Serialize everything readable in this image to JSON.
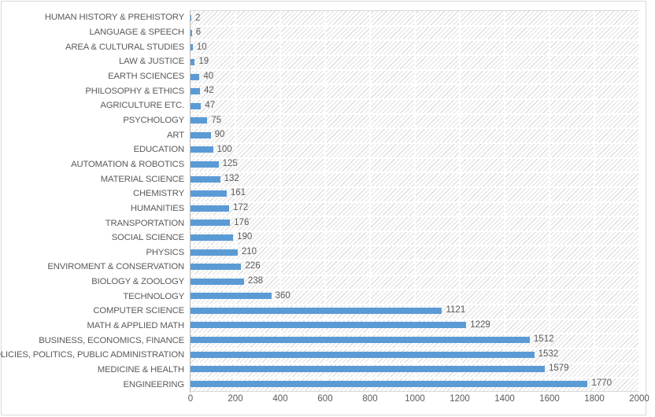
{
  "chart_data": {
    "type": "bar",
    "orientation": "horizontal",
    "title": "",
    "subtitle": "",
    "xlabel": "",
    "ylabel": "",
    "xlim": [
      0,
      2000
    ],
    "xticks": [
      0,
      200,
      400,
      600,
      800,
      1000,
      1200,
      1400,
      1600,
      1800,
      2000
    ],
    "grid": true,
    "gridlines": "vertical and horizontal",
    "legend": "none",
    "data_labels": true,
    "series_color": "#5b9bd5",
    "label_color": "#5a5a5a",
    "plot_background": "#ffffff",
    "plot_pattern": "light diagonal hatch",
    "categories": [
      "HUMAN HISTORY & PREHISTORY",
      "LANGUAGE & SPEECH",
      "AREA & CULTURAL STUDIES",
      "LAW & JUSTICE",
      "EARTH SCIENCES",
      "PHILOSOPHY & ETHICS",
      "AGRICULTURE ETC.",
      "PSYCHOLOGY",
      "ART",
      "EDUCATION",
      "AUTOMATION & ROBOTICS",
      "MATERIAL SCIENCE",
      "CHEMISTRY",
      "HUMANITIES",
      "TRANSPORTATION",
      "SOCIAL SCIENCE",
      "PHYSICS",
      "ENVIROMENT & CONSERVATION",
      "BIOLOGY & ZOOLOGY",
      "TECHNOLOGY",
      "COMPUTER SCIENCE",
      "MATH & APPLIED MATH",
      "BUSINESS, ECONOMICS, FINANCE",
      "POLICIES, POLITICS, PUBLIC ADMINISTRATION",
      "MEDICINE & HEALTH",
      "ENGINEERING"
    ],
    "values": [
      2,
      6,
      10,
      19,
      40,
      42,
      47,
      75,
      90,
      100,
      125,
      132,
      161,
      172,
      176,
      190,
      210,
      226,
      238,
      360,
      1121,
      1229,
      1512,
      1532,
      1579,
      1770
    ]
  }
}
